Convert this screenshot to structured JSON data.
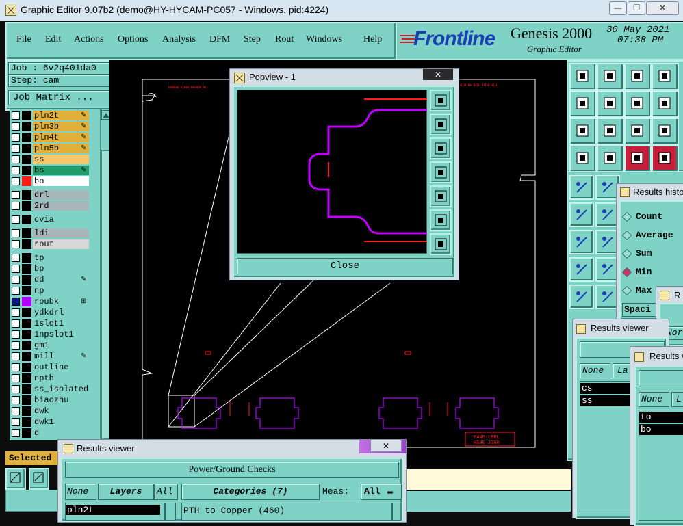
{
  "window": {
    "title": "Graphic Editor 9.07b2 (demo@HY-HYCAM-PC057 - Windows, pid:4224)",
    "minimize": "—",
    "restore": "❐",
    "close": "✕"
  },
  "menu": {
    "items": [
      {
        "label": "File"
      },
      {
        "label": "Edit"
      },
      {
        "label": "Actions"
      },
      {
        "label": "Options"
      },
      {
        "label": "Analysis"
      },
      {
        "label": "DFM"
      },
      {
        "label": "Step"
      },
      {
        "label": "Rout"
      },
      {
        "label": "Windows"
      },
      {
        "label": "Help"
      }
    ]
  },
  "brand": {
    "logo": "Frontline",
    "product": "Genesis 2000",
    "subtitle": "Graphic Editor",
    "date": "30 May 2021",
    "time": "07:38 PM"
  },
  "job": {
    "job_label": "Job : 6v2q401da0",
    "step_label": "Step: cam",
    "matrix_button": "Job Matrix ..."
  },
  "layers": {
    "items": [
      {
        "name": "pln2t",
        "color": "#e0b03a",
        "swatch": "#000000",
        "icon": "✎"
      },
      {
        "name": "pln3b",
        "color": "#e0b03a",
        "swatch": "#000000",
        "icon": "✎"
      },
      {
        "name": "pln4t",
        "color": "#e0b03a",
        "swatch": "#000000",
        "icon": "✎"
      },
      {
        "name": "pln5b",
        "color": "#e0b03a",
        "swatch": "#000000",
        "icon": "✎"
      },
      {
        "name": "ss",
        "color": "#f6c86a",
        "swatch": "#000000",
        "icon": ""
      },
      {
        "name": "bs",
        "color": "#1e9c6a",
        "swatch": "#000000",
        "icon": "✎"
      },
      {
        "name": "bo",
        "color": "#ffffff",
        "swatch": "#ff1a1a",
        "icon": ""
      },
      {
        "name": "drl",
        "color": "#a7b6b9",
        "swatch": "#000000",
        "icon": ""
      },
      {
        "name": "2rd",
        "color": "#a7b6b9",
        "swatch": "#000000",
        "icon": ""
      },
      {
        "name": "cvia",
        "color": "#7fd3c6",
        "swatch": "#000000",
        "icon": ""
      },
      {
        "name": "ldi",
        "color": "#a7b6b9",
        "swatch": "#000000",
        "icon": ""
      },
      {
        "name": "rout",
        "color": "#d8d8d8",
        "swatch": "#000000",
        "icon": ""
      },
      {
        "name": "tp",
        "color": "#7fd3c6",
        "swatch": "#000000",
        "icon": ""
      },
      {
        "name": "bp",
        "color": "#7fd3c6",
        "swatch": "#000000",
        "icon": ""
      },
      {
        "name": "dd",
        "color": "#7fd3c6",
        "swatch": "#000000",
        "icon": "✎"
      },
      {
        "name": "np",
        "color": "#7fd3c6",
        "swatch": "#000000",
        "icon": ""
      },
      {
        "name": "roubk",
        "color": "#7fd3c6",
        "swatch": "#b400ff",
        "icon": "⊞",
        "check": "#0a1a80"
      },
      {
        "name": "ydkdrl",
        "color": "#7fd3c6",
        "swatch": "#000000",
        "icon": ""
      },
      {
        "name": "1slot1",
        "color": "#7fd3c6",
        "swatch": "#000000",
        "icon": ""
      },
      {
        "name": "1npslot1",
        "color": "#7fd3c6",
        "swatch": "#000000",
        "icon": ""
      },
      {
        "name": "gm1",
        "color": "#7fd3c6",
        "swatch": "#000000",
        "icon": ""
      },
      {
        "name": "mill",
        "color": "#7fd3c6",
        "swatch": "#000000",
        "icon": "✎"
      },
      {
        "name": "outline",
        "color": "#7fd3c6",
        "swatch": "#000000",
        "icon": ""
      },
      {
        "name": "npth",
        "color": "#7fd3c6",
        "swatch": "#000000",
        "icon": ""
      },
      {
        "name": "ss_isolated",
        "color": "#7fd3c6",
        "swatch": "#000000",
        "icon": ""
      },
      {
        "name": "biaozhu",
        "color": "#7fd3c6",
        "swatch": "#000000",
        "icon": ""
      },
      {
        "name": "dwk",
        "color": "#7fd3c6",
        "swatch": "#000000",
        "icon": ""
      },
      {
        "name": "dwk1",
        "color": "#7fd3c6",
        "swatch": "#000000",
        "icon": ""
      },
      {
        "name": "d",
        "color": "#7fd3c6",
        "swatch": "#000000",
        "icon": ""
      }
    ],
    "selected_label": "Selected :"
  },
  "popview": {
    "title": "Popview - 1",
    "close_x": "✕",
    "close_button": "Close"
  },
  "results_histogram": {
    "title": "Results histo",
    "options": [
      {
        "label": "Count",
        "selected": false
      },
      {
        "label": "Average",
        "selected": false
      },
      {
        "label": "Sum",
        "selected": false
      },
      {
        "label": "Min",
        "selected": true
      },
      {
        "label": "Max",
        "selected": false
      }
    ],
    "spacing": "Spaci"
  },
  "results_viewer_main": {
    "title": "Results viewer",
    "close_x": "✕",
    "check_name": "Power/Ground Checks",
    "none_button": "None",
    "layers_button": "Layers",
    "all_button": "All",
    "categories_button": "Categories (7)",
    "meas_label": "Meas:",
    "meas_value": "All",
    "layer_list": [
      "pln2t"
    ],
    "category_list": [
      "PTH to Copper (460)"
    ]
  },
  "results_viewer_2": {
    "title": "Results viewer",
    "none_button": "None",
    "la_button": "La",
    "list": [
      "cs",
      "ss"
    ]
  },
  "results_viewer_3": {
    "title": "Results v",
    "none_button": "None",
    "d_button": "L",
    "list": [
      "to",
      "bo"
    ]
  },
  "results_viewer_4": {
    "title": "R",
    "none_button": "Nor"
  },
  "canvas": {
    "board_label": "PANB LBBL",
    "board_sub": "HCHE 2300",
    "colors": {
      "outline": "#ffffff",
      "rout": "#b400ff",
      "copper": "#ff1a1a"
    }
  }
}
